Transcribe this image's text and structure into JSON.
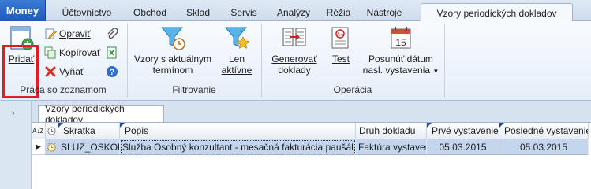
{
  "tabs": {
    "app": "Money",
    "items": [
      "Účtovníctvo",
      "Obchod",
      "Sklad",
      "Servis",
      "Analýzy",
      "Réžia",
      "Nástroje"
    ],
    "active": "Vzory periodických dokladov"
  },
  "ribbon": {
    "groups": {
      "praca": "Práca so zoznamom",
      "filtrovanie": "Filtrovanie",
      "operacia": "Operácia"
    },
    "pridat": "Pridať",
    "opravit": "Opraviť",
    "kopirovat": "Kopírovať",
    "vyniat": "Vyňať",
    "vzory_line1": "Vzory s aktuálnym",
    "vzory_line2": "termínom",
    "len_line1": "Len",
    "len_line2": "aktívne",
    "generovat_line1": "Generovať",
    "generovat_line2": "doklady",
    "test": "Test",
    "posunut_line1": "Posunúť dátum",
    "posunut_line2": "nasl. vystavenia"
  },
  "document": {
    "tab_label": "Vzory periodických dokladov",
    "columns": {
      "sort": "A↓Z",
      "skratka": "Skratka",
      "popis": "Popis",
      "druh": "Druh dokladu",
      "prve": "Prvé vystavenie",
      "posledne": "Posledné vystavenie"
    },
    "rows": [
      {
        "skratka": "SLUZ_OSKON",
        "popis": "Služba Osobný konzultant - mesačná fakturácia paušál",
        "druh": "Faktúra vystavená",
        "prve": "05.03.2015",
        "posledne": "05.03.2015"
      }
    ]
  },
  "colors": {
    "accent": "#1d5bb6",
    "highlight": "#e31b23",
    "selection": "#c3d6ee"
  }
}
